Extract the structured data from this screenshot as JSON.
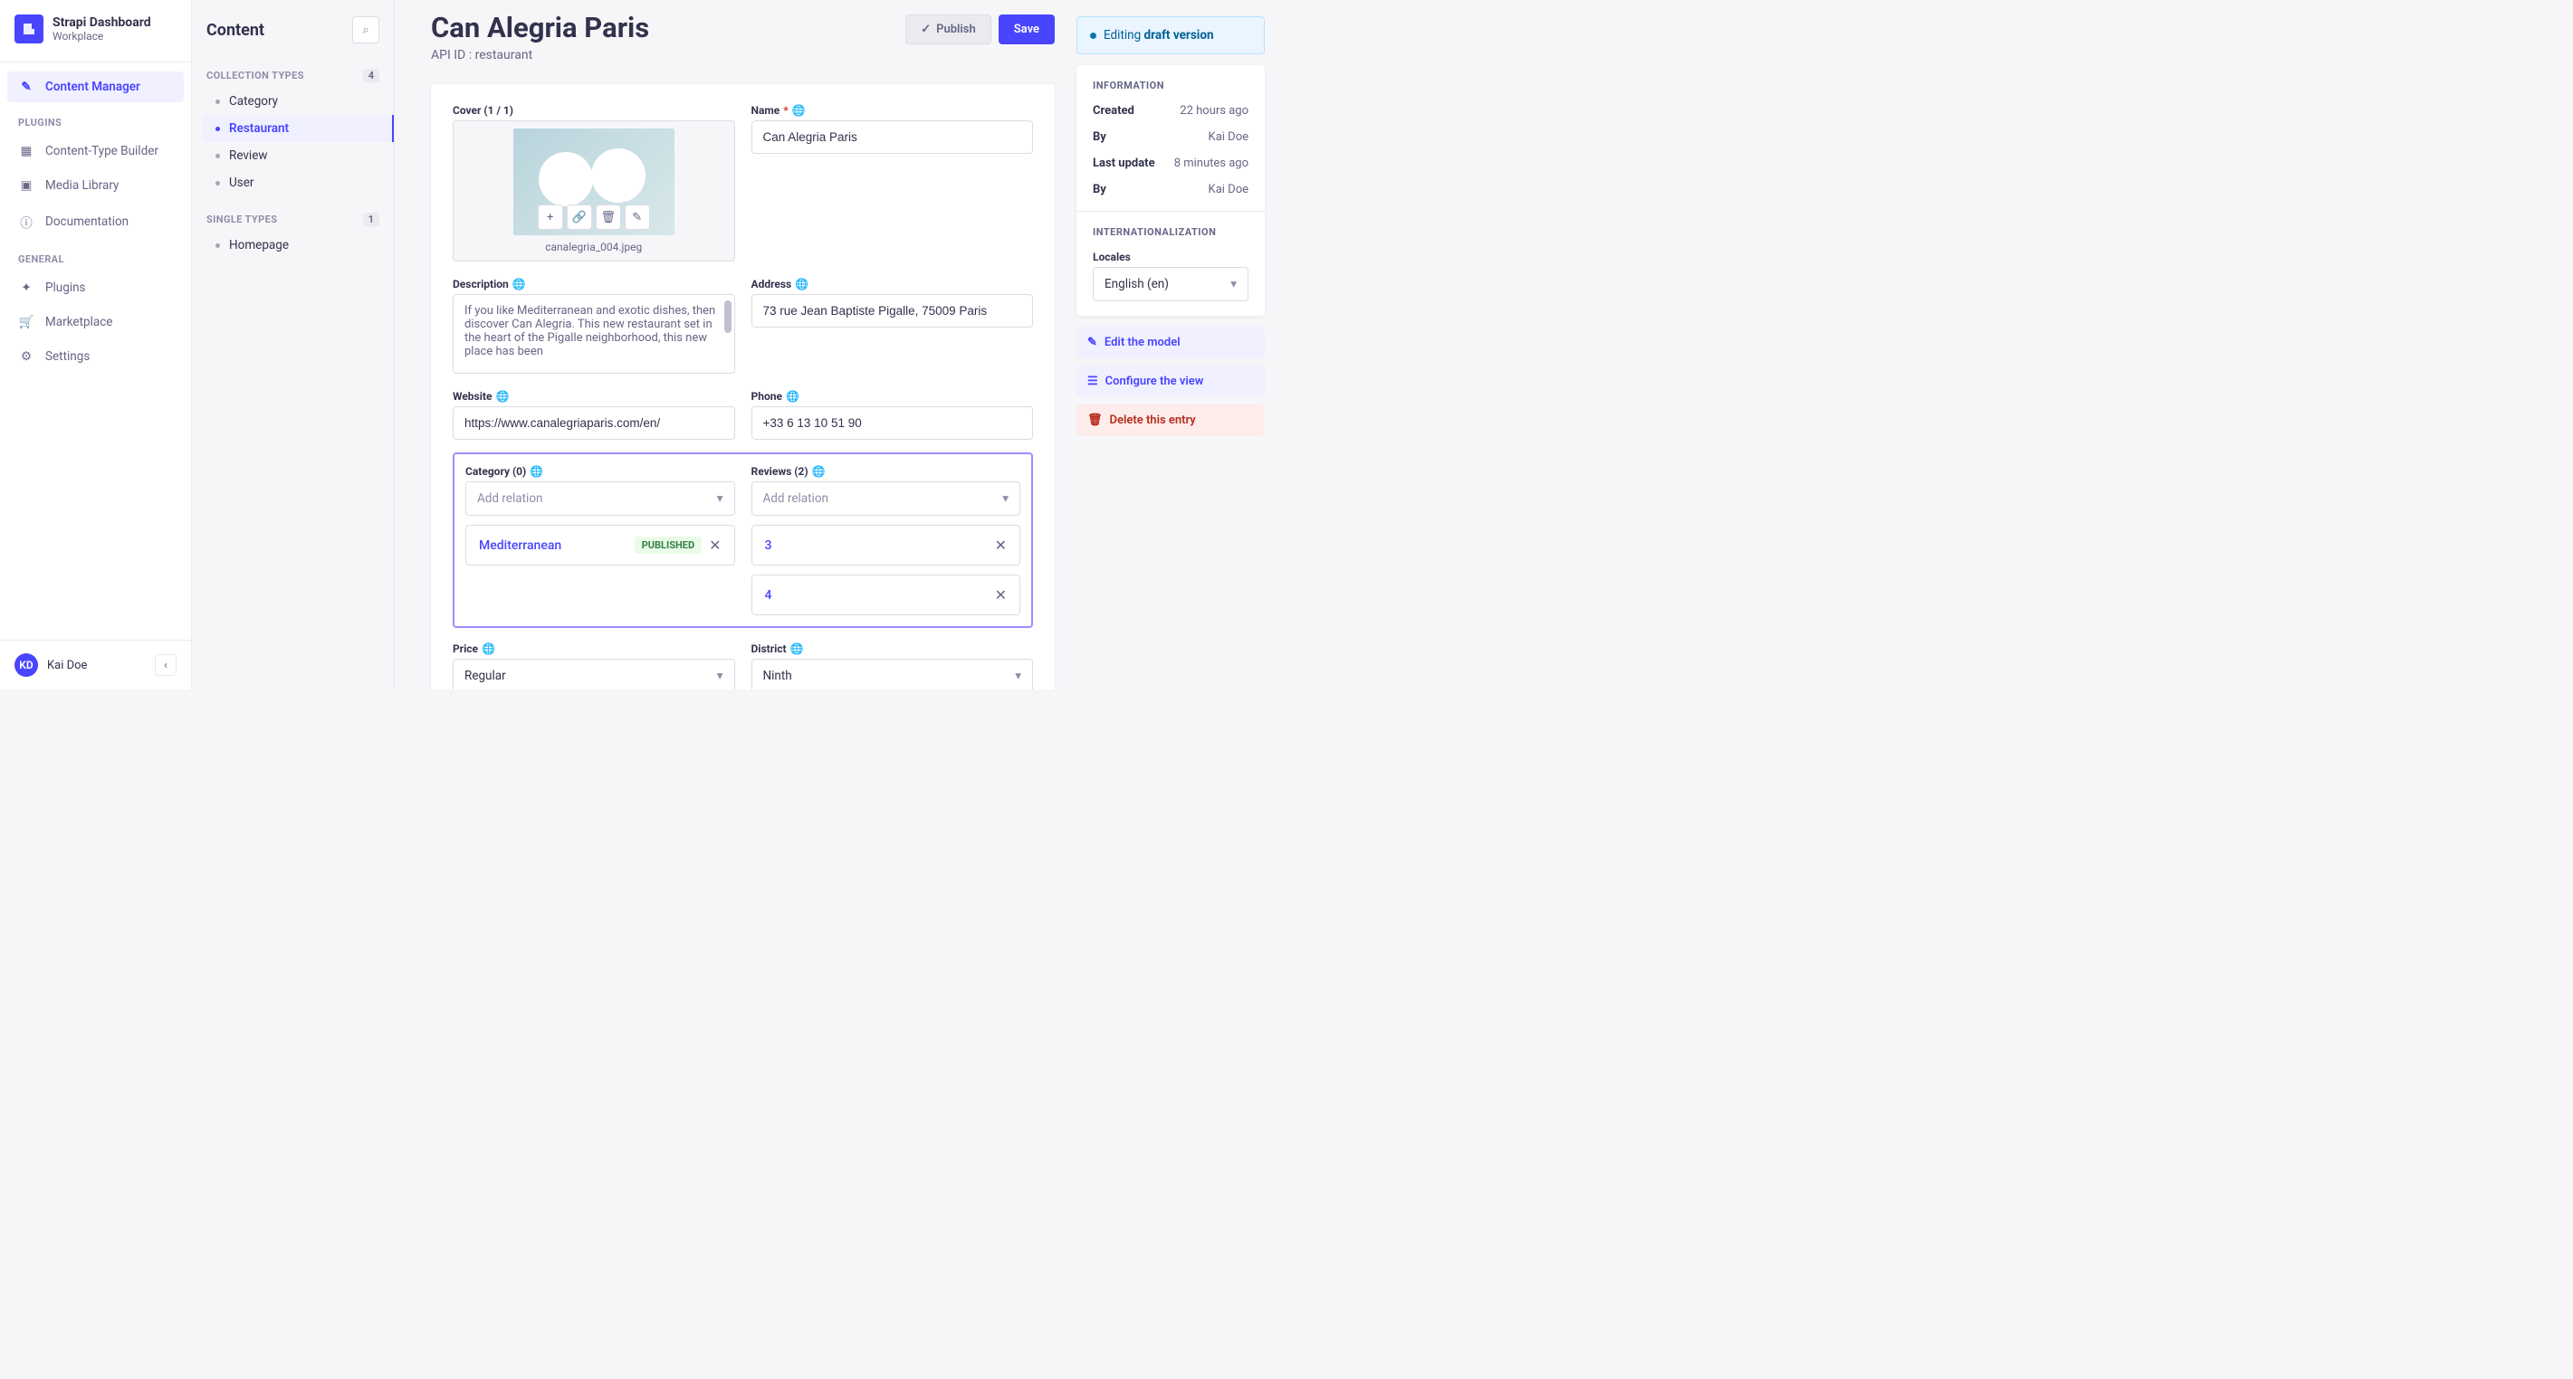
{
  "brand": {
    "title": "Strapi Dashboard",
    "subtitle": "Workplace"
  },
  "main_nav": {
    "content_manager": "Content Manager",
    "plugins_label": "PLUGINS",
    "content_type_builder": "Content-Type Builder",
    "media_library": "Media Library",
    "documentation": "Documentation",
    "general_label": "GENERAL",
    "plugins": "Plugins",
    "marketplace": "Marketplace",
    "settings": "Settings"
  },
  "user": {
    "initials": "KD",
    "name": "Kai Doe"
  },
  "content_sidebar": {
    "title": "Content",
    "collection_label": "COLLECTION TYPES",
    "collection_count": "4",
    "items_collection": [
      "Category",
      "Restaurant",
      "Review",
      "User"
    ],
    "single_label": "SINGLE TYPES",
    "single_count": "1",
    "items_single": [
      "Homepage"
    ]
  },
  "page": {
    "title": "Can Alegria Paris",
    "subtitle": "API ID : restaurant",
    "publish_btn": "Publish",
    "save_btn": "Save"
  },
  "form": {
    "cover_label": "Cover (1 / 1)",
    "cover_filename": "canalegria_004.jpeg",
    "name_label": "Name",
    "name_value": "Can Alegria Paris",
    "description_label": "Description",
    "description_value": "If you like Mediterranean and exotic dishes, then discover Can Alegria. This new restaurant set in the heart of the Pigalle neighborhood, this new place has been",
    "address_label": "Address",
    "address_value": "73 rue Jean Baptiste Pigalle, 75009 Paris",
    "website_label": "Website",
    "website_value": "https://www.canalegriaparis.com/en/",
    "phone_label": "Phone",
    "phone_value": "+33 6 13 10 51 90",
    "category_label": "Category (0)",
    "reviews_label": "Reviews (2)",
    "add_relation_placeholder": "Add relation",
    "category_tag": "Mediterranean",
    "published_badge": "PUBLISHED",
    "reviews": [
      "3",
      "4"
    ],
    "price_label": "Price",
    "price_value": "Regular",
    "district_label": "District",
    "district_value": "Ninth"
  },
  "status": {
    "prefix": "Editing ",
    "bold": "draft version"
  },
  "info": {
    "title": "INFORMATION",
    "created_label": "Created",
    "created_value": "22 hours ago",
    "by_label": "By",
    "by_value": "Kai Doe",
    "updated_label": "Last update",
    "updated_value": "8 minutes ago",
    "intl_label": "INTERNATIONALIZATION",
    "locales_label": "Locales",
    "locale_value": "English (en)"
  },
  "actions": {
    "edit_model": "Edit the model",
    "configure_view": "Configure the view",
    "delete_entry": "Delete this entry"
  }
}
